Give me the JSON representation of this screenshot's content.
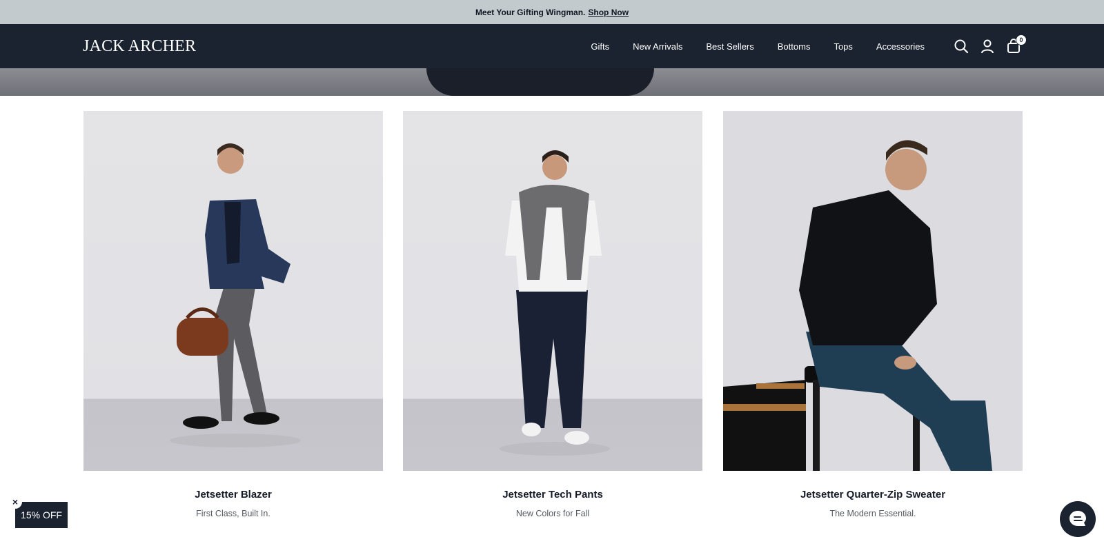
{
  "announcement": {
    "text": "Meet Your Gifting Wingman.",
    "link": "Shop Now"
  },
  "header": {
    "logo": "JACK ARCHER",
    "menu": [
      "Gifts",
      "New Arrivals",
      "Best Sellers",
      "Bottoms",
      "Tops",
      "Accessories"
    ],
    "cart_count": "0",
    "icons": [
      "search-icon",
      "account-icon",
      "cart-icon"
    ]
  },
  "products": [
    {
      "title": "Jetsetter Blazer",
      "subtitle": "First Class, Built In."
    },
    {
      "title": "Jetsetter Tech Pants",
      "subtitle": "New Colors for Fall"
    },
    {
      "title": "Jetsetter Quarter-Zip Sweater",
      "subtitle": "The Modern Essential."
    }
  ],
  "promo": {
    "discount_label": "15% OFF",
    "close_label": "×"
  },
  "colors": {
    "nav_bg": "#1b2230",
    "announce_bg": "#c2cace",
    "accent": "#ffffff"
  }
}
